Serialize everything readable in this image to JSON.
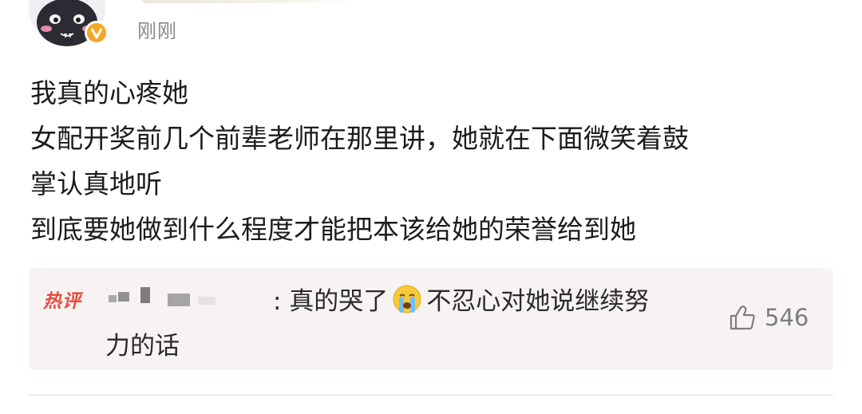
{
  "post": {
    "timestamp": "刚刚",
    "lines": [
      "我真的心疼她",
      "女配开奖前几个前辈老师在那里讲，她就在下面微笑着鼓",
      "掌认真地听",
      "到底要她做到什么程度才能把本该给她的荣誉给到她"
    ]
  },
  "hot_comment": {
    "badge": "热评",
    "name_suffix": ":",
    "text_before_emoji": "真的哭了",
    "emoji": "crying-face-icon",
    "text_after_emoji": "不忍心对她说继续努",
    "text_line2": "力的话",
    "like_icon": "thumbs-up-icon",
    "like_count": "546"
  },
  "colors": {
    "hot_badge": "#ea4b3c",
    "verified_badge": "#f5a623",
    "comment_background": "#f7f3f2",
    "meta_text": "#8a8a8a"
  }
}
